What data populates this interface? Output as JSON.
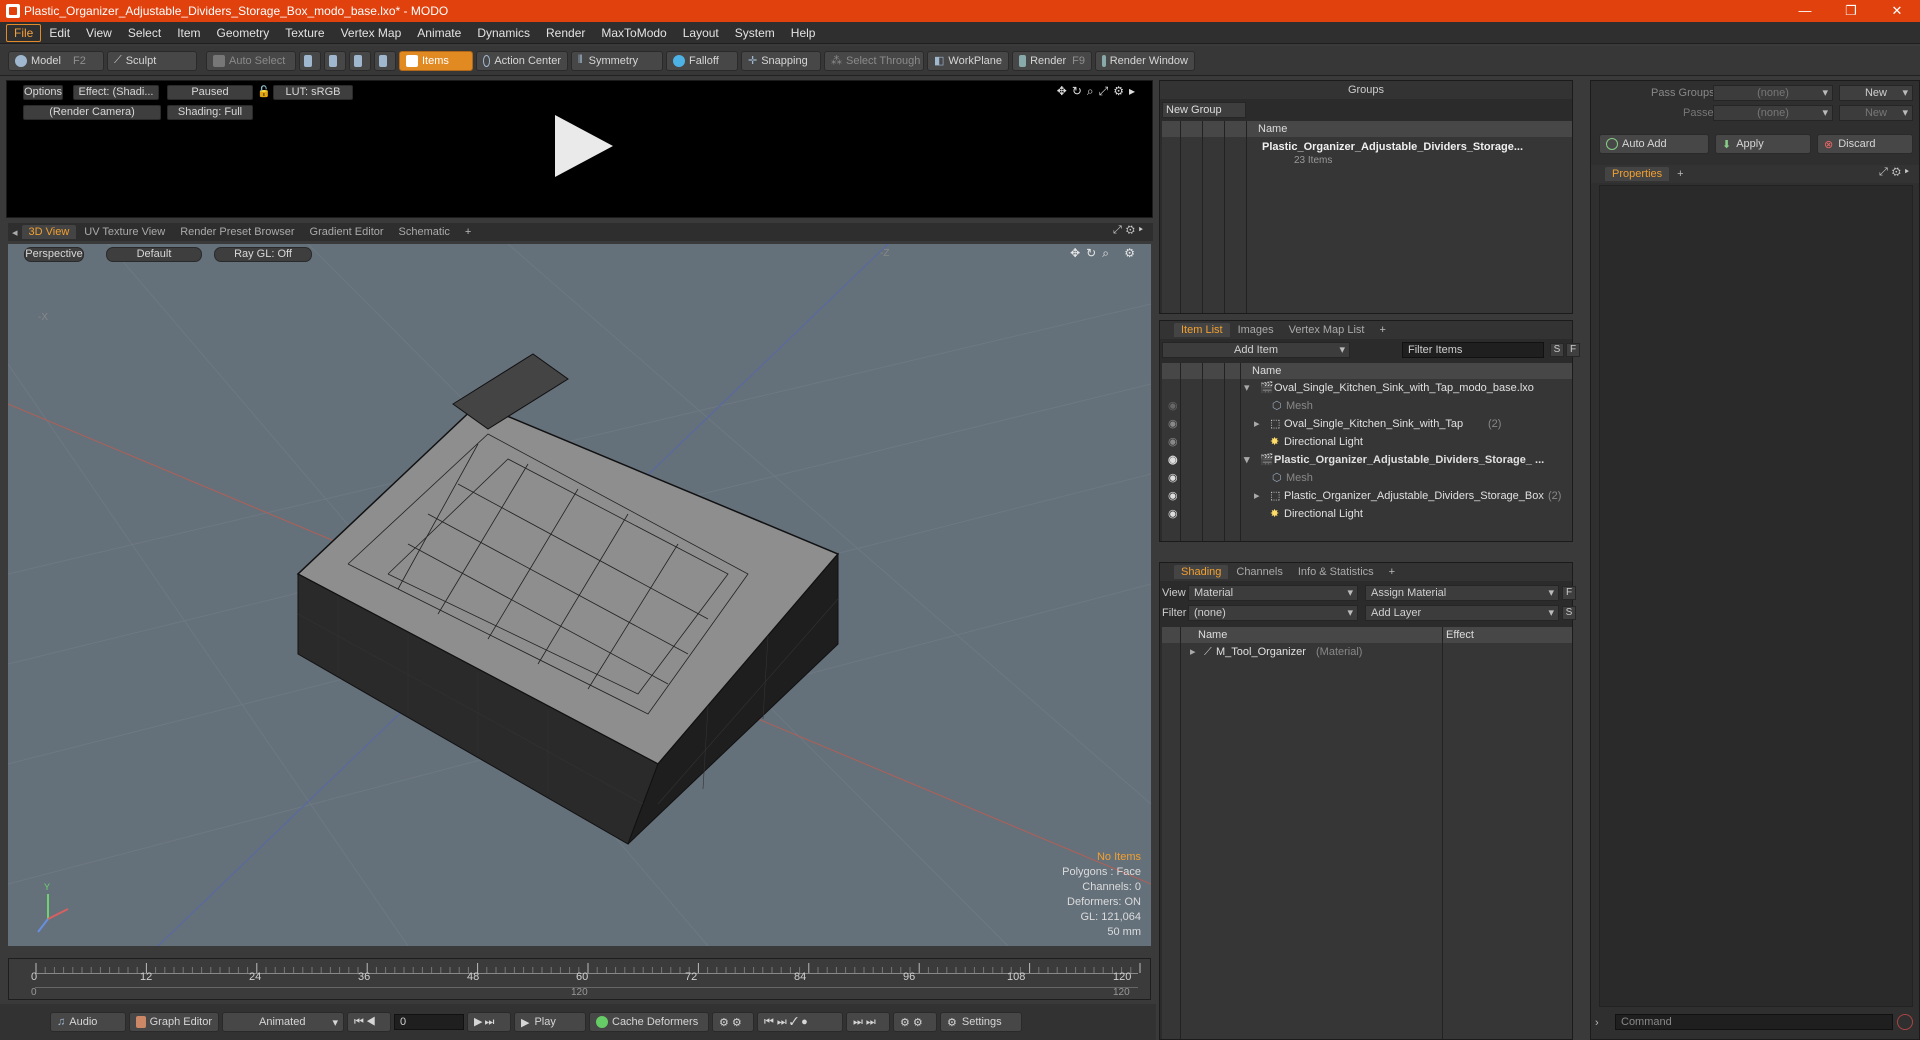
{
  "window": {
    "title": "Plastic_Organizer_Adjustable_Dividers_Storage_Box_modo_base.lxo* - MODO",
    "controls": [
      "—",
      "❐",
      "✕"
    ]
  },
  "menu": [
    "File",
    "Edit",
    "View",
    "Select",
    "Item",
    "Geometry",
    "Texture",
    "Vertex Map",
    "Animate",
    "Dynamics",
    "Render",
    "MaxToModo",
    "Layout",
    "System",
    "Help"
  ],
  "toolbar": {
    "model": "Model",
    "model_key": "F2",
    "sculpt": "Sculpt",
    "auto_select": "Auto Select",
    "items": "Items",
    "action_center": "Action Center",
    "symmetry": "Symmetry",
    "falloff": "Falloff",
    "snapping": "Snapping",
    "select_through": "Select Through",
    "workplane": "WorkPlane",
    "render": "Render",
    "render_key": "F9",
    "render_window": "Render Window"
  },
  "render_preview": {
    "options": "Options",
    "effect": "Effect: (Shadi...",
    "paused": "Paused",
    "lut": "LUT: sRGB",
    "camera": "(Render Camera)",
    "shading": "Shading: Full"
  },
  "view_tabs": [
    "3D View",
    "UV Texture View",
    "Render Preset Browser",
    "Gradient Editor",
    "Schematic",
    "+"
  ],
  "viewport": {
    "perspective": "Perspective",
    "default": "Default",
    "raygl": "Ray GL: Off",
    "axis_neg_x": "-X",
    "axis_neg_z": "-Z",
    "info": {
      "no_items": "No Items",
      "polygons": "Polygons : Face",
      "channels": "Channels: 0",
      "deformers": "Deformers: ON",
      "gl": "GL: 121,064",
      "size": "50 mm"
    }
  },
  "timeline": {
    "ticks": [
      "0",
      "12",
      "24",
      "36",
      "48",
      "60",
      "72",
      "84",
      "96",
      "108",
      "120"
    ],
    "start": "0",
    "mid": "120",
    "end": "120"
  },
  "bottom": {
    "audio": "Audio",
    "graph_editor": "Graph Editor",
    "animated": "Animated",
    "frame": "0",
    "play": "Play",
    "cache": "Cache Deformers",
    "settings": "Settings"
  },
  "groups": {
    "title": "Groups",
    "new_group": "New Group",
    "col_name": "Name",
    "item_name": "Plastic_Organizer_Adjustable_Dividers_Storage...",
    "item_count": "23 Items"
  },
  "item_list": {
    "tabs": [
      "Item List",
      "Images",
      "Vertex Map List",
      "+"
    ],
    "add_item": "Add Item",
    "filter": "Filter Items",
    "s": "S",
    "f": "F",
    "col_name": "Name",
    "rows": [
      {
        "label": "Oval_Single_Kitchen_Sink_with_Tap_modo_base.lxo",
        "suffix": ""
      },
      {
        "label": "Mesh",
        "suffix": ""
      },
      {
        "label": "Oval_Single_Kitchen_Sink_with_Tap",
        "suffix": "(2)"
      },
      {
        "label": "Directional Light",
        "suffix": ""
      },
      {
        "label": "Plastic_Organizer_Adjustable_Dividers_Storage_ ...",
        "suffix": ""
      },
      {
        "label": "Mesh",
        "suffix": ""
      },
      {
        "label": "Plastic_Organizer_Adjustable_Dividers_Storage_Box",
        "suffix": "(2)"
      },
      {
        "label": "Directional Light",
        "suffix": ""
      }
    ]
  },
  "shading": {
    "tabs": [
      "Shading",
      "Channels",
      "Info & Statistics",
      "+"
    ],
    "view_label": "View",
    "view_value": "Material",
    "assign": "Assign Material",
    "f": "F",
    "filter_label": "Filter",
    "filter_value": "(none)",
    "add_layer": "Add Layer",
    "s": "S",
    "col_name": "Name",
    "col_effect": "Effect",
    "material": "M_Tool_Organizer",
    "material_type": "(Material)"
  },
  "right": {
    "pass_groups": "Pass Groups",
    "passes": "Passes",
    "none1": "(none)",
    "none2": "(none)",
    "new1": "New",
    "new2": "New",
    "auto_add": "Auto Add",
    "apply": "Apply",
    "discard": "Discard",
    "properties": "Properties",
    "plus": "+",
    "command": "Command"
  },
  "colors": {
    "accent": "#e0410d",
    "orange": "#f2a030",
    "viewport": "#64707a"
  }
}
